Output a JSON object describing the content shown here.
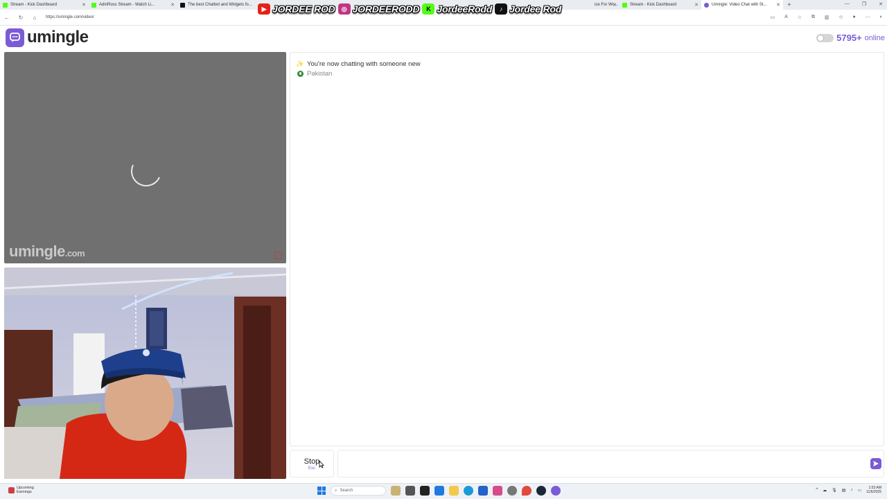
{
  "browser": {
    "tabs": [
      {
        "label": "Stream - Kick Dashboard",
        "color": "#53fc18"
      },
      {
        "label": "AdinRoss Stream - Watch Li...",
        "color": "#53fc18"
      },
      {
        "label": "The best Chatbot and Widgets fo...",
        "color": "#111111"
      },
      {
        "label": "",
        "color": "#cccccc"
      },
      {
        "label": "",
        "color": "#cccccc"
      },
      {
        "label": "",
        "color": "#cccccc"
      },
      {
        "label": "ice For Wo...",
        "color": "#999999"
      },
      {
        "label": "Stream - Kick Dashboard",
        "color": "#53fc18"
      },
      {
        "label": "Umingle: Video Chat with St...",
        "color": "#7b5bd6"
      }
    ],
    "url": "https://umingle.com/video/"
  },
  "overlay": {
    "items": [
      {
        "icon": "youtube-icon",
        "handle": "JORDEE ROD",
        "color": "#e62117"
      },
      {
        "icon": "instagram-icon",
        "handle": "JORDEERODD",
        "color": "#c13584"
      },
      {
        "icon": "kick-icon",
        "handle": "JordeeRodd",
        "color": "#53fc18"
      },
      {
        "icon": "tiktok-icon",
        "handle": "Jordee Rod",
        "color": "#111111"
      }
    ]
  },
  "app": {
    "brand": "umingle",
    "online_count": "5795+",
    "online_label": "online",
    "accent": "#7b5bd6"
  },
  "video": {
    "watermark_main": "umingle",
    "watermark_suffix": ".com"
  },
  "chat": {
    "messages": [
      {
        "icon": "sparkles-icon",
        "text": "You're now chatting with someone new"
      },
      {
        "icon": "flag-icon",
        "text": "Pakistan"
      }
    ]
  },
  "controls": {
    "stop_label": "Stop",
    "stop_key": "Esc",
    "message_placeholder": ""
  },
  "taskbar": {
    "weather_line1": "Upcoming",
    "weather_line2": "Earnings",
    "search_placeholder": "Search",
    "time": "1:53 AM",
    "date": "11/6/2025"
  }
}
